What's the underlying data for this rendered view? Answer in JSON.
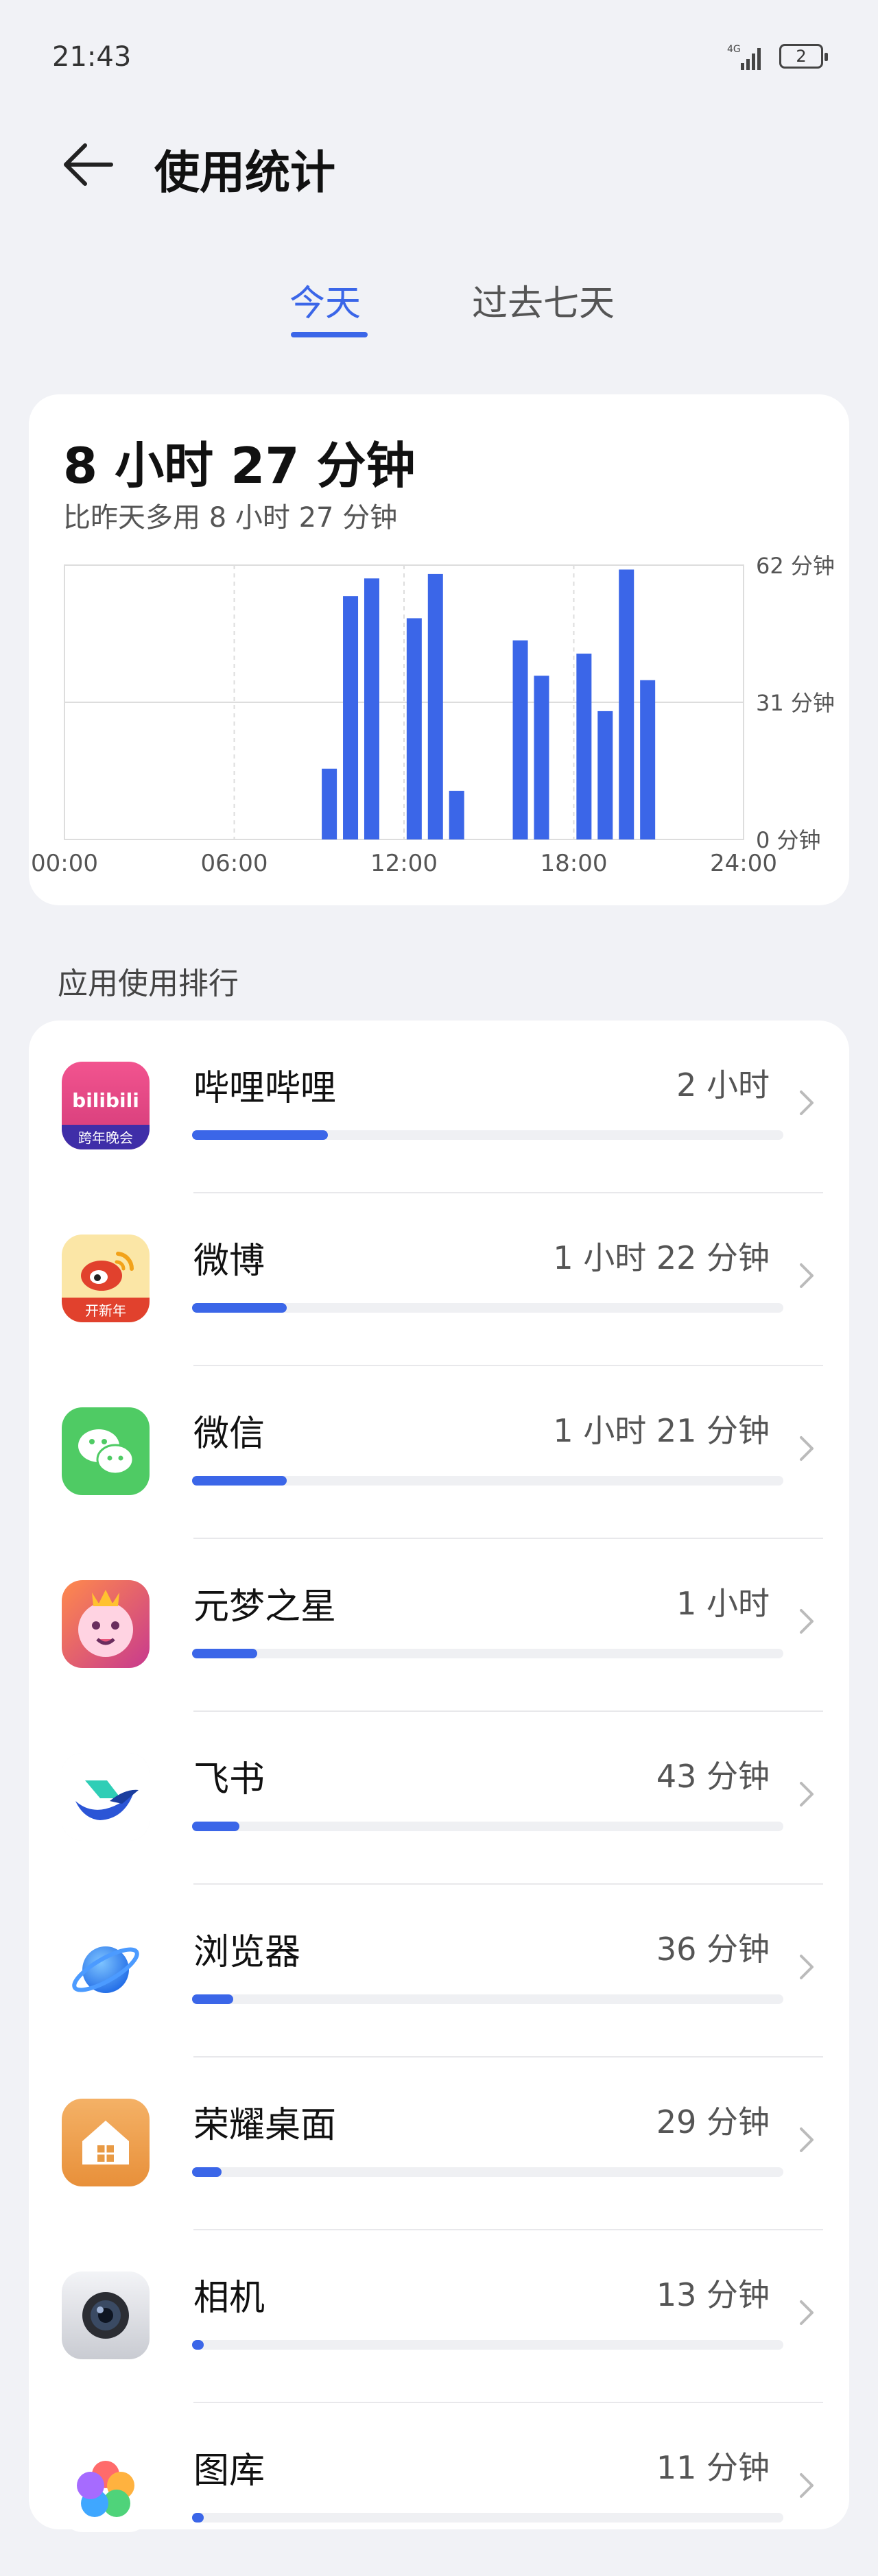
{
  "status": {
    "time": "21:43",
    "battery": "2",
    "network": "4G"
  },
  "header": {
    "title": "使用统计"
  },
  "tabs": [
    {
      "label": "今天",
      "active": true
    },
    {
      "label": "过去七天",
      "active": false
    }
  ],
  "summary": {
    "total": "8 小时 27 分钟",
    "comparison": "比昨天多用 8 小时 27 分钟"
  },
  "chart_data": {
    "type": "bar",
    "x_ticks": [
      "00:00",
      "06:00",
      "12:00",
      "18:00",
      "24:00"
    ],
    "y_ticks": [
      "62 分钟",
      "31 分钟",
      "0 分钟"
    ],
    "ylim": [
      0,
      62
    ],
    "unit": "分钟",
    "grid": true,
    "color": "#3B66E8",
    "bars": [
      {
        "hour": 9.0,
        "value": 16
      },
      {
        "hour": 9.75,
        "value": 55
      },
      {
        "hour": 10.5,
        "value": 59
      },
      {
        "hour": 12.0,
        "value": 50
      },
      {
        "hour": 12.75,
        "value": 60
      },
      {
        "hour": 13.5,
        "value": 11
      },
      {
        "hour": 15.75,
        "value": 45
      },
      {
        "hour": 16.5,
        "value": 37
      },
      {
        "hour": 18.0,
        "value": 42
      },
      {
        "hour": 18.75,
        "value": 29
      },
      {
        "hour": 19.5,
        "value": 61
      },
      {
        "hour": 20.25,
        "value": 36
      }
    ]
  },
  "ranking": {
    "title": "应用使用排行",
    "apps": [
      {
        "name": "哔哩哔哩",
        "duration": "2 小时",
        "fraction": 0.23,
        "icon": "bilibili-icon"
      },
      {
        "name": "微博",
        "duration": "1 小时 22 分钟",
        "fraction": 0.16,
        "icon": "weibo-icon"
      },
      {
        "name": "微信",
        "duration": "1 小时 21 分钟",
        "fraction": 0.16,
        "icon": "wechat-icon"
      },
      {
        "name": "元梦之星",
        "duration": "1 小时",
        "fraction": 0.11,
        "icon": "game-icon"
      },
      {
        "name": "飞书",
        "duration": "43 分钟",
        "fraction": 0.08,
        "icon": "feishu-icon"
      },
      {
        "name": "浏览器",
        "duration": "36 分钟",
        "fraction": 0.07,
        "icon": "browser-icon"
      },
      {
        "name": "荣耀桌面",
        "duration": "29 分钟",
        "fraction": 0.05,
        "icon": "home-icon"
      },
      {
        "name": "相机",
        "duration": "13 分钟",
        "fraction": 0.02,
        "icon": "camera-icon"
      },
      {
        "name": "图库",
        "duration": "11 分钟",
        "fraction": 0.02,
        "icon": "gallery-icon"
      }
    ]
  },
  "icon_texts": {
    "bilibili": "bilibili",
    "bilibili_tag": "跨年晚会",
    "weibo_tag": "开新年"
  }
}
